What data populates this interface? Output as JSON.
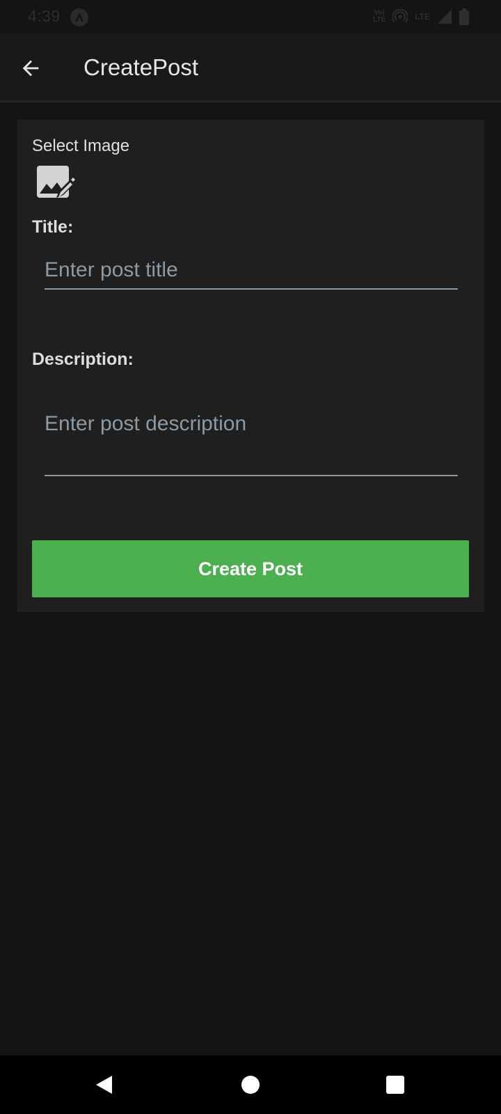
{
  "status_bar": {
    "time": "4:39",
    "volte_line1": "Vo)",
    "volte_line2": "LTE",
    "lte_label": "LTE",
    "icons": [
      "app-notification-icon",
      "volte-icon",
      "hotspot-icon",
      "lte-icon",
      "signal-icon",
      "battery-icon"
    ]
  },
  "app_bar": {
    "title": "CreatePost",
    "back_icon": "arrow-left-icon"
  },
  "form": {
    "select_image_label": "Select Image",
    "image_icon": "image-edit-icon",
    "title_label": "Title:",
    "title_placeholder": "Enter post title",
    "title_value": "",
    "description_label": "Description:",
    "description_placeholder": "Enter post description",
    "description_value": "",
    "submit_label": "Create Post"
  },
  "nav_bar": {
    "icons": [
      "back-triangle-icon",
      "home-circle-icon",
      "recents-square-icon"
    ]
  },
  "colors": {
    "background": "#141414",
    "card": "#1f1f1f",
    "accent": "#4caf50",
    "input_line": "#8c9aa6"
  }
}
